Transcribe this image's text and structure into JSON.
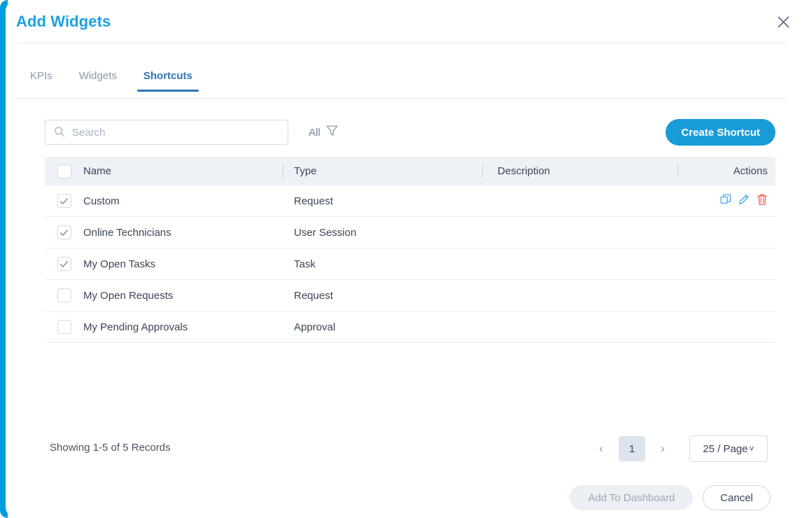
{
  "modal": {
    "title": "Add Widgets",
    "close_icon": "close-icon"
  },
  "tabs": [
    {
      "label": "KPIs",
      "active": false
    },
    {
      "label": "Widgets",
      "active": false
    },
    {
      "label": "Shortcuts",
      "active": true
    }
  ],
  "toolbar": {
    "search_value": "",
    "search_placeholder": "Search",
    "search_icon": "search-icon",
    "filter_label": "All",
    "filter_icon": "filter-icon",
    "create_label": "Create Shortcut"
  },
  "table": {
    "columns": [
      "Name",
      "Type",
      "Description",
      "Actions"
    ],
    "header_checkbox_checked": false,
    "rows": [
      {
        "checked": true,
        "name": "Custom",
        "type": "Request",
        "description": "",
        "has_actions": true
      },
      {
        "checked": true,
        "name": "Online Technicians",
        "type": "User Session",
        "description": "",
        "has_actions": false
      },
      {
        "checked": true,
        "name": "My Open Tasks",
        "type": "Task",
        "description": "",
        "has_actions": false
      },
      {
        "checked": false,
        "name": "My Open Requests",
        "type": "Request",
        "description": "",
        "has_actions": false
      },
      {
        "checked": false,
        "name": "My Pending Approvals",
        "type": "Approval",
        "description": "",
        "has_actions": false
      }
    ],
    "row_action_icons": [
      "copy-icon",
      "edit-icon",
      "delete-icon"
    ]
  },
  "footer": {
    "records_text": "Showing 1-5 of 5 Records",
    "prev_label": "‹",
    "current_page": "1",
    "next_label": "›",
    "page_size_label": "25 / Page",
    "page_size_chevron": "chevron-down-icon",
    "add_to_dashboard_label": "Add To Dashboard",
    "cancel_label": "Cancel"
  },
  "colors": {
    "accent": "#009ddc",
    "title": "#1ba0e2",
    "primary_button": "#189cd8",
    "tab_active": "#2f74b5",
    "header_row_bg": "#eef1f6",
    "delete_icon": "#f2544b",
    "action_icon": "#3aa7e0"
  }
}
